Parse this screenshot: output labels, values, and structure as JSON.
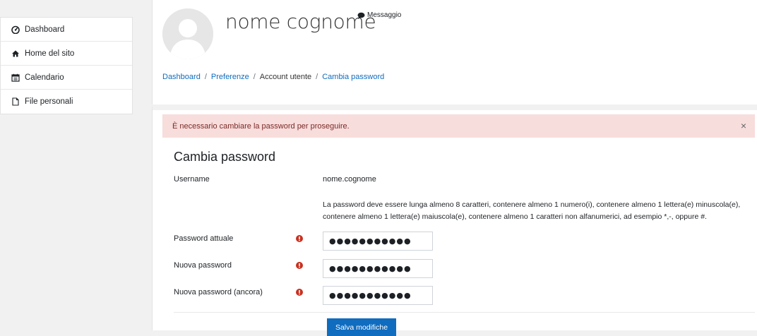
{
  "sidebar": {
    "items": [
      {
        "label": "Dashboard",
        "icon": "dashboard-icon"
      },
      {
        "label": "Home del sito",
        "icon": "home-icon"
      },
      {
        "label": "Calendario",
        "icon": "calendar-icon"
      },
      {
        "label": "File personali",
        "icon": "file-icon"
      }
    ]
  },
  "header": {
    "user_name": "nome cognome",
    "message_label": "Messaggio",
    "breadcrumb": [
      "Dashboard",
      "Preferenze",
      "Account utente",
      "Cambia password"
    ]
  },
  "alert": {
    "text": "È necessario cambiare la password per proseguire.",
    "close": "×"
  },
  "form": {
    "title": "Cambia password",
    "username_label": "Username",
    "username_value": "nome.cognome",
    "password_hint": "La password deve essere lunga almeno 8 caratteri, contenere almeno 1 numero(i), contenere almeno 1 lettera(e) minuscola(e), contenere almeno 1 lettera(e) maiuscola(e), contenere almeno 1 caratteri non alfanumerici, ad esempio *,-, oppure #.",
    "current_password_label": "Password attuale",
    "new_password_label": "Nuova password",
    "new_password_again_label": "Nuova password (ancora)",
    "current_password_value": "●●●●●●●●●●●",
    "new_password_value": "●●●●●●●●●●●",
    "new_password_again_value": "●●●●●●●●●●●",
    "save_label": "Salva modifiche"
  },
  "colors": {
    "accent": "#0f6cbf",
    "alert_bg": "#f7dddc",
    "required": "#ca3120"
  }
}
